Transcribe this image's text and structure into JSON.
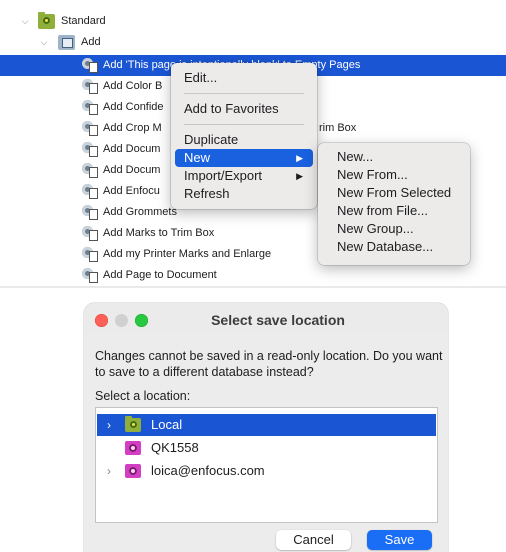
{
  "tree": {
    "root": {
      "label": "Standard"
    },
    "category": {
      "label": "Add"
    },
    "items": [
      {
        "label": "Add 'This page is intentionally blank' to Empty Pages",
        "selected": true
      },
      {
        "label": "Add Color B",
        "selected": false
      },
      {
        "label": "Add Confide",
        "selected": false
      },
      {
        "label": "Add Crop M",
        "suffix": "rim Box",
        "selected": false
      },
      {
        "label": "Add Docum",
        "selected": false
      },
      {
        "label": "Add Docum",
        "selected": false
      },
      {
        "label": "Add Enfocu",
        "selected": false
      },
      {
        "label": "Add Grommets",
        "selected": false
      },
      {
        "label": "Add Marks to Trim Box",
        "selected": false
      },
      {
        "label": "Add my Printer Marks and Enlarge",
        "selected": false
      },
      {
        "label": "Add Page to Document",
        "selected": false
      }
    ]
  },
  "context_menu": {
    "items": [
      {
        "label": "Edit..."
      },
      {
        "label": "Add to Favorites"
      },
      {
        "label": "Duplicate"
      },
      {
        "label": "New",
        "highlighted": true,
        "has_submenu": true
      },
      {
        "label": "Import/Export",
        "has_submenu": true
      },
      {
        "label": "Refresh"
      }
    ],
    "submenu_arrow": "▶"
  },
  "submenu": {
    "items": [
      {
        "label": "New..."
      },
      {
        "label": "New From..."
      },
      {
        "label": "New From Selected"
      },
      {
        "label": "New from File..."
      },
      {
        "label": "New Group..."
      },
      {
        "label": "New Database..."
      }
    ]
  },
  "dialog": {
    "title": "Select save location",
    "message": "Changes cannot be saved in a read-only location. Do you want to save to a different database instead?",
    "subtitle": "Select a location:",
    "locations": [
      {
        "label": "Local",
        "selected": true,
        "expandable": true,
        "icon": "folder-icon"
      },
      {
        "label": "QK1558",
        "selected": false,
        "expandable": false,
        "icon": "database-icon"
      },
      {
        "label": "loica@enfocus.com",
        "selected": false,
        "expandable": true,
        "icon": "database-icon"
      }
    ],
    "cancel_label": "Cancel",
    "save_label": "Save"
  },
  "colors": {
    "selection": "#1a55d4",
    "menu_highlight": "#1a61df",
    "save_button": "#1a6ef5",
    "folder_green": "#8fae3a",
    "database_magenta": "#d43ec4"
  }
}
